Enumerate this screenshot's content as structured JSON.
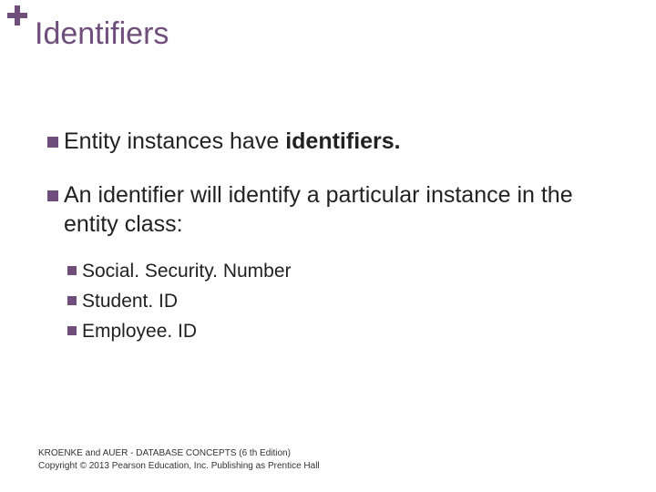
{
  "title": "Identifiers",
  "bullets": [
    {
      "prefix": "Entity instances have ",
      "bold": "identifiers.",
      "suffix": ""
    },
    {
      "prefix": "An identifier will identify a particular instance in the entity class:",
      "bold": "",
      "suffix": "",
      "sub": [
        "Social. Security. Number",
        "Student. ID",
        "Employee. ID"
      ]
    }
  ],
  "footer": {
    "line1": "KROENKE and AUER -  DATABASE CONCEPTS (6 th Edition)",
    "line2": "Copyright © 2013 Pearson Education, Inc. Publishing as Prentice Hall"
  }
}
